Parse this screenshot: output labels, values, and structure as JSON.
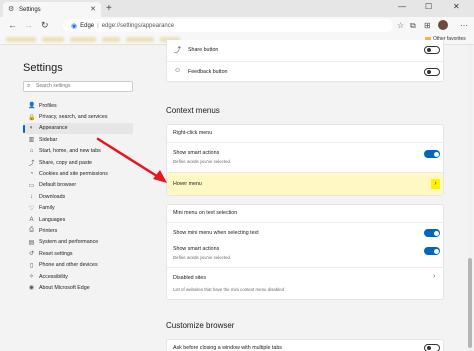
{
  "tab": {
    "title": "Settings",
    "close": "✕",
    "new": "+"
  },
  "window_controls": {
    "minimize": "—",
    "maximize": "☐",
    "close": "✕"
  },
  "address": {
    "brand": "Edge",
    "separator": "|",
    "url": "edge://settings/appearance"
  },
  "favorites": {
    "other": "Other favorites"
  },
  "nav": {
    "title": "Settings",
    "search_placeholder": "Search settings",
    "items": [
      {
        "icon": "profile-icon",
        "glyph": "👤",
        "label": "Profiles"
      },
      {
        "icon": "lock-icon",
        "glyph": "🔒",
        "label": "Privacy, search, and services"
      },
      {
        "icon": "appearance-icon",
        "glyph": "◐",
        "label": "Appearance"
      },
      {
        "icon": "sidebar-icon",
        "glyph": "▥",
        "label": "Sidebar"
      },
      {
        "icon": "home-icon",
        "glyph": "⌂",
        "label": "Start, home, and new tabs"
      },
      {
        "icon": "share-icon",
        "glyph": "⤴",
        "label": "Share, copy and paste"
      },
      {
        "icon": "cookie-icon",
        "glyph": "◔",
        "label": "Cookies and site permissions"
      },
      {
        "icon": "browser-icon",
        "glyph": "▭",
        "label": "Default browser"
      },
      {
        "icon": "download-icon",
        "glyph": "↓",
        "label": "Downloads"
      },
      {
        "icon": "family-icon",
        "glyph": "♡",
        "label": "Family"
      },
      {
        "icon": "languages-icon",
        "glyph": "A",
        "label": "Languages"
      },
      {
        "icon": "printer-icon",
        "glyph": "⎙",
        "label": "Printers"
      },
      {
        "icon": "system-icon",
        "glyph": "▤",
        "label": "System and performance"
      },
      {
        "icon": "reset-icon",
        "glyph": "↺",
        "label": "Reset settings"
      },
      {
        "icon": "phone-icon",
        "glyph": "▯",
        "label": "Phone and other devices"
      },
      {
        "icon": "accessibility-icon",
        "glyph": "✧",
        "label": "Accessibility"
      },
      {
        "icon": "edge-icon",
        "glyph": "◉",
        "label": "About Microsoft Edge"
      }
    ],
    "active_index": 2
  },
  "main": {
    "top_card": {
      "share_button": "Share button",
      "feedback_button": "Feedback button"
    },
    "context_menus": {
      "title": "Context menus",
      "right_click_title": "Right-click menu",
      "show_smart_actions": "Show smart actions",
      "show_smart_actions_sub": "Define words you've selected.",
      "hover_menu": "Hover menu"
    },
    "mini_menu": {
      "title": "Mini menu on text selection",
      "show_mini_menu": "Show mini menu when selecting text",
      "show_smart_actions": "Show smart actions",
      "show_smart_actions_sub": "Define words you've selected.",
      "disabled_sites": "Disabled sites",
      "disabled_sites_sub": "List of websites that have the mini context menu disabled"
    },
    "customize": {
      "title": "Customize browser",
      "ask_before_closing": "Ask before closing a window with multiple tabs"
    }
  },
  "colors": {
    "accent": "#0067c0",
    "highlight": "#fff200",
    "arrow": "#e8141e"
  }
}
